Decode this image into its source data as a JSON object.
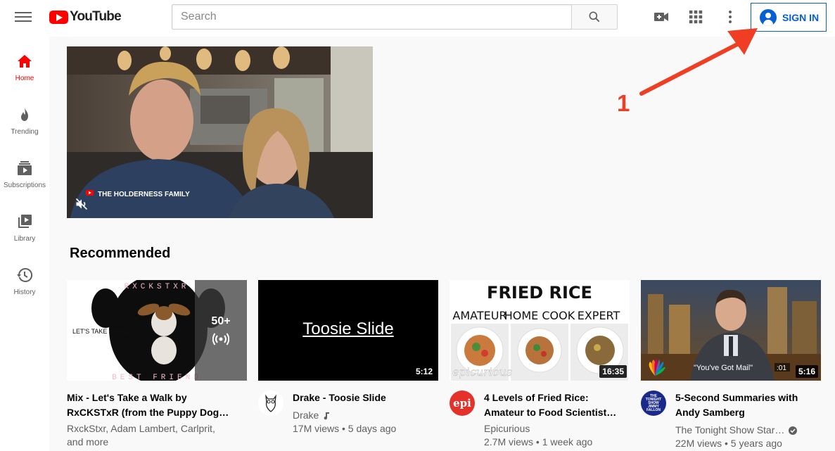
{
  "header": {
    "logo_text": "YouTube",
    "search_placeholder": "Search",
    "signin_label": "SIGN IN"
  },
  "sidebar": {
    "items": [
      {
        "label": "Home",
        "icon": "home-icon",
        "active": true
      },
      {
        "label": "Trending",
        "icon": "flame-icon",
        "active": false
      },
      {
        "label": "Subscriptions",
        "icon": "subscriptions-icon",
        "active": false
      },
      {
        "label": "Library",
        "icon": "library-icon",
        "active": false
      },
      {
        "label": "History",
        "icon": "history-icon",
        "active": false
      }
    ]
  },
  "featured": {
    "channel_watermark": "THE HOLDERNESS FAMILY",
    "muted_icon": "volume-off-icon"
  },
  "recommended": {
    "heading": "Recommended",
    "videos": [
      {
        "title_line1": "Mix - Let's Take a Walk by",
        "title_line2": "RxCKSTxR (from the Puppy Dog…",
        "meta_line1": "RxckStxr, Adam Lambert, Carlprit,",
        "meta_line2": "and more",
        "thumb_top_text": "RXCKSTXR",
        "thumb_left_text": "LET'S TAKE a WALK",
        "thumb_bottom_text": "BEST FRIEND",
        "playlist_count": "50+"
      },
      {
        "title": "Drake - Toosie Slide",
        "channel": "Drake",
        "stats": "17M views • 5 days ago",
        "thumb_text": "Toosie Slide",
        "duration": "5:12"
      },
      {
        "title_line1": "4 Levels of Fried Rice:",
        "title_line2": "Amateur to Food Scientist…",
        "channel": "Epicurious",
        "stats": "2.7M views • 1 week ago",
        "thumb_heading": "FRIED RICE",
        "thumb_levels": [
          "AMATEUR",
          "HOME COOK",
          "EXPERT"
        ],
        "thumb_brand": "epicurious",
        "avatar_text": "epi",
        "duration": "16:35"
      },
      {
        "title_line1": "5-Second Summaries with",
        "title_line2": "Andy Samberg",
        "channel": "The Tonight Show Star…",
        "stats": "22M views • 5 years ago",
        "thumb_caption": "\"You've Got Mail\"",
        "thumb_timer": ":01",
        "avatar_text": "THE TONIGHT SHOW JIMMY FALLON",
        "duration": "5:16"
      }
    ]
  },
  "annotation": {
    "number": "1",
    "color": "#ef3e23"
  },
  "colors": {
    "brand_red": "#ff0000",
    "link_blue": "#065fd4",
    "meta_gray": "#606060"
  }
}
